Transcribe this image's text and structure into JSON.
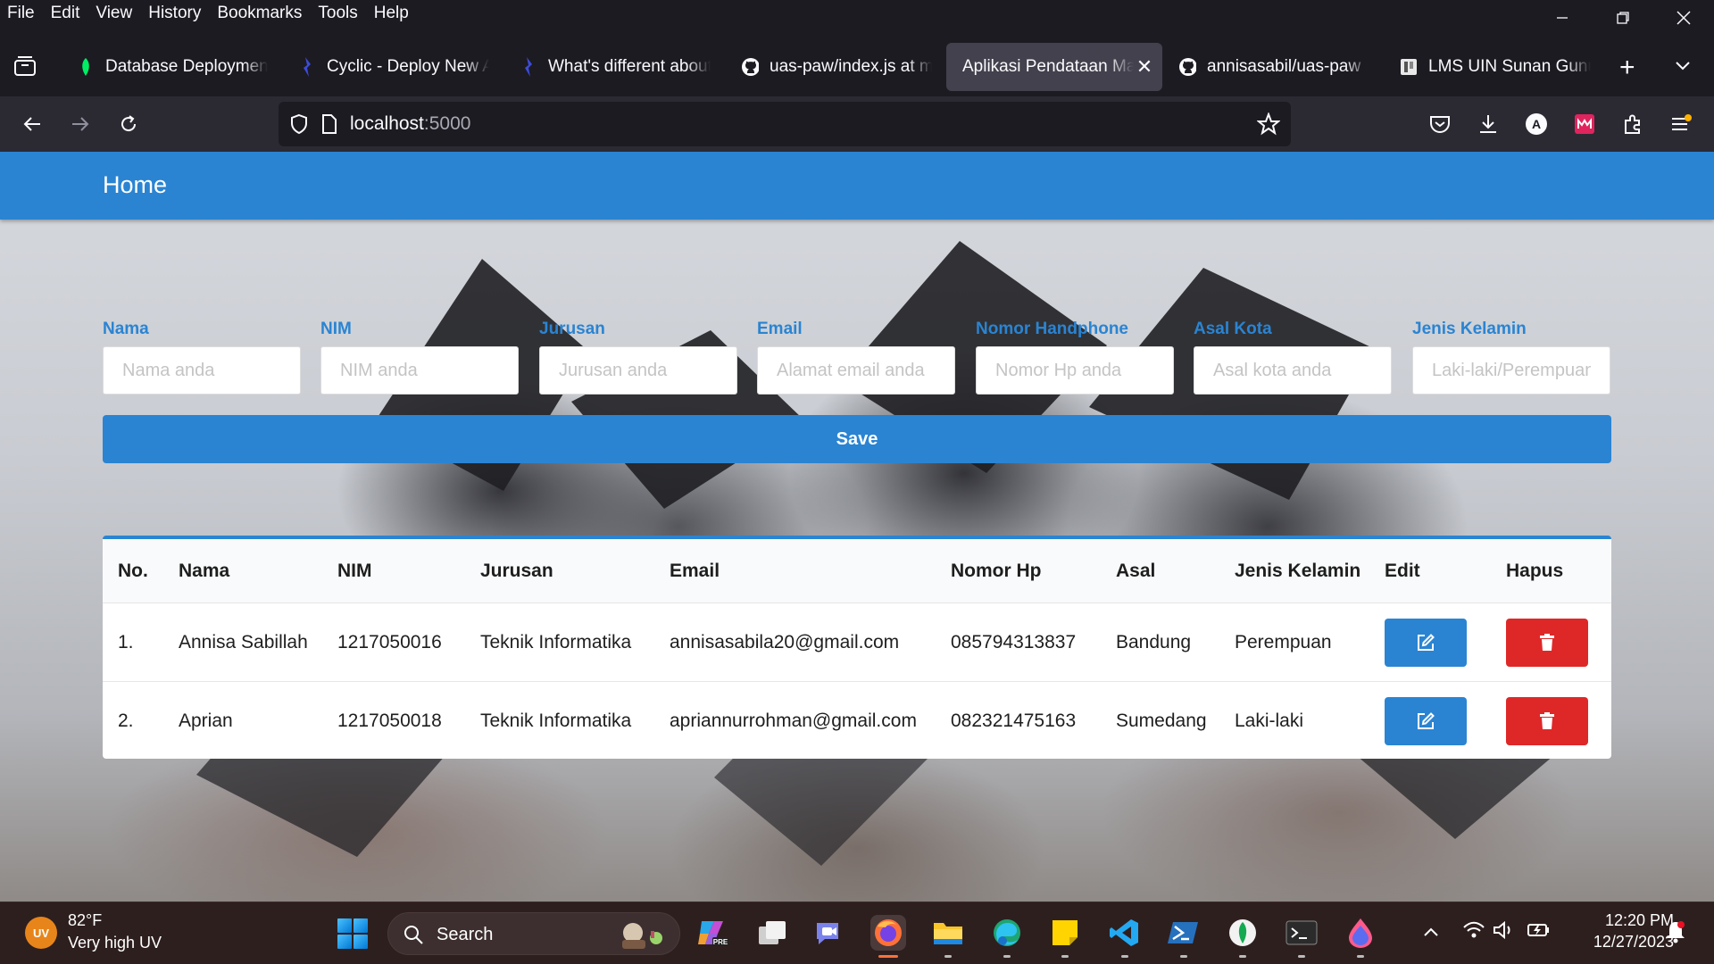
{
  "menubar": {
    "items": [
      "File",
      "Edit",
      "View",
      "History",
      "Bookmarks",
      "Tools",
      "Help"
    ]
  },
  "tabs": [
    {
      "title": "Database Deployments",
      "icon": "mongodb-leaf-icon"
    },
    {
      "title": "Cyclic - Deploy New Ap",
      "icon": "cyclic-icon"
    },
    {
      "title": "What's different about",
      "icon": "cyclic-icon"
    },
    {
      "title": "uas-paw/index.js at ma",
      "icon": "github-icon"
    },
    {
      "title": "Aplikasi Pendataan Maha",
      "icon": "none",
      "active": true
    },
    {
      "title": "annisasabil/uas-paw",
      "icon": "github-icon"
    },
    {
      "title": "LMS UIN Sunan Gunun",
      "icon": "lms-icon"
    }
  ],
  "address": {
    "host": "localhost",
    "port": ":5000"
  },
  "app": {
    "title": "Home",
    "form": {
      "fields": [
        {
          "label": "Nama",
          "placeholder": "Nama anda"
        },
        {
          "label": "NIM",
          "placeholder": "NIM anda"
        },
        {
          "label": "Jurusan",
          "placeholder": "Jurusan anda"
        },
        {
          "label": "Email",
          "placeholder": "Alamat email anda"
        },
        {
          "label": "Nomor Handphone",
          "placeholder": "Nomor Hp anda"
        },
        {
          "label": "Asal Kota",
          "placeholder": "Asal kota anda"
        },
        {
          "label": "Jenis Kelamin",
          "placeholder": "Laki-laki/Perempuan"
        }
      ],
      "save_label": "Save"
    },
    "table": {
      "headers": [
        "No.",
        "Nama",
        "NIM",
        "Jurusan",
        "Email",
        "Nomor Hp",
        "Asal",
        "Jenis Kelamin",
        "Edit",
        "Hapus"
      ],
      "rows": [
        {
          "no": "1.",
          "nama": "Annisa Sabillah",
          "nim": "1217050016",
          "jurusan": "Teknik Informatika",
          "email": "annisasabila20@gmail.com",
          "hp": "085794313837",
          "asal": "Bandung",
          "jk": "Perempuan"
        },
        {
          "no": "2.",
          "nama": "Aprian",
          "nim": "1217050018",
          "jurusan": "Teknik Informatika",
          "email": "apriannurrohman@gmail.com",
          "hp": "082321475163",
          "asal": "Sumedang",
          "jk": "Laki-laki"
        }
      ]
    }
  },
  "taskbar": {
    "weather_badge": "UV",
    "weather_temp": "82°F",
    "weather_desc": "Very high UV",
    "search_label": "Search",
    "time": "12:20 PM",
    "date": "12/27/2023"
  },
  "colors": {
    "accent": "#2a84d2",
    "danger": "#de2828"
  }
}
